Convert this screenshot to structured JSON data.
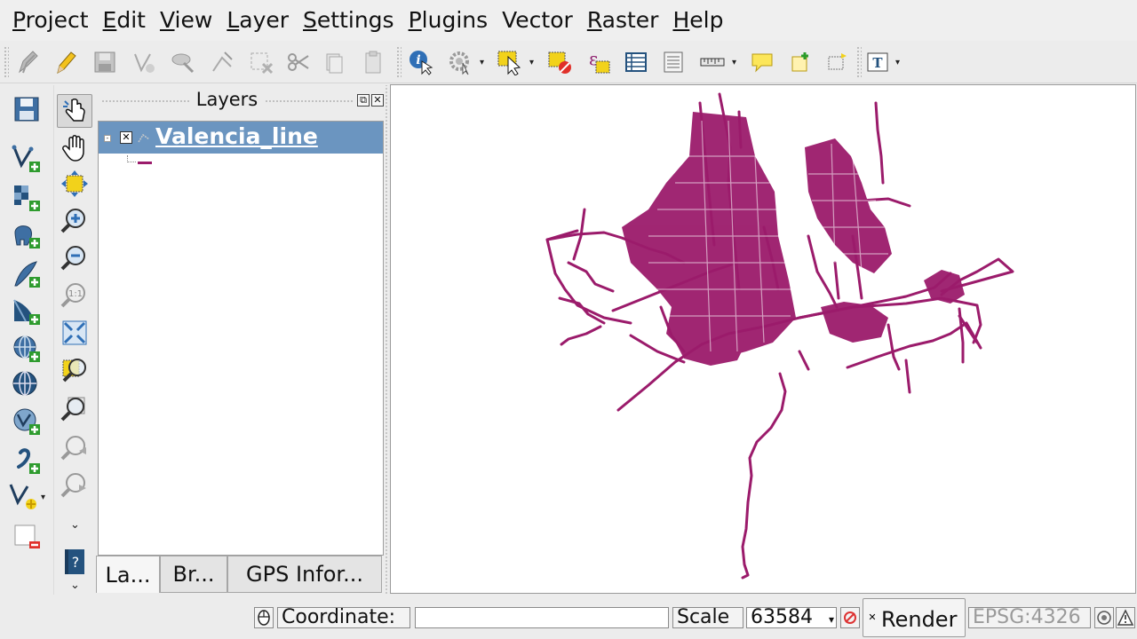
{
  "menu": {
    "items": [
      {
        "label": "Project",
        "key": "P",
        "rest": "roject"
      },
      {
        "label": "Edit",
        "key": "E",
        "rest": "dit"
      },
      {
        "label": "View",
        "key": "V",
        "rest": "iew"
      },
      {
        "label": "Layer",
        "key": "L",
        "rest": "ayer"
      },
      {
        "label": "Settings",
        "key": "S",
        "rest": "ettings"
      },
      {
        "label": "Plugins",
        "key": "P",
        "rest": "lugins"
      },
      {
        "label": "Vector",
        "key": "",
        "rest": "Vector",
        "mid_key": "o"
      },
      {
        "label": "Raster",
        "key": "R",
        "rest": "aster"
      },
      {
        "label": "Help",
        "key": "H",
        "rest": "elp"
      }
    ]
  },
  "layers_panel": {
    "title": "Layers",
    "float_glyph": "⧉",
    "close_glyph": "✕",
    "layer": {
      "name": "Valencia_line",
      "collapse_glyph": "-",
      "visible_glyph": "✕",
      "color": "#9b1b6b"
    },
    "tabs": [
      {
        "label": "La..."
      },
      {
        "label": "Br..."
      },
      {
        "label": "GPS Infor..."
      }
    ]
  },
  "status": {
    "coordinate_label": "Coordinate:",
    "coordinate_value": "",
    "scale_label": "Scale",
    "scale_value": "63584",
    "render_label": "Render",
    "render_check": "✕",
    "crs": "EPSG:4326"
  },
  "colors": {
    "line_color": "#9b1b6b",
    "selected_row": "#6b95c0",
    "accent_yellow": "#f2d21b"
  }
}
